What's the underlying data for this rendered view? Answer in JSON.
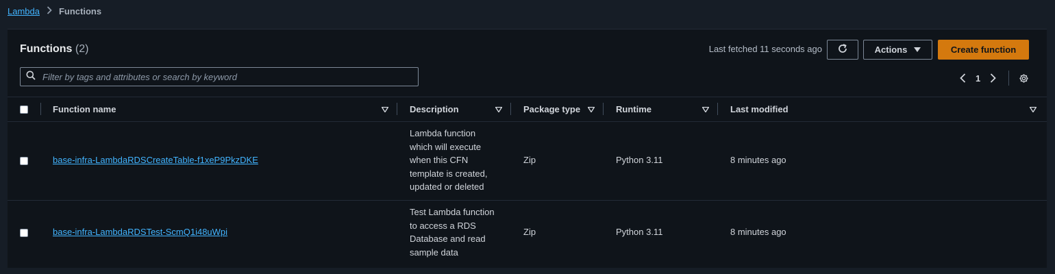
{
  "breadcrumb": {
    "root": "Lambda",
    "separator": "›",
    "current": "Functions"
  },
  "header": {
    "title": "Functions",
    "count": "(2)",
    "last_fetched": "Last fetched 11 seconds ago",
    "refresh_icon": "refresh-icon",
    "actions_label": "Actions",
    "create_label": "Create function"
  },
  "search": {
    "placeholder": "Filter by tags and attributes or search by keyword",
    "value": ""
  },
  "pagination": {
    "page": "1"
  },
  "table": {
    "columns": [
      "Function name",
      "Description",
      "Package type",
      "Runtime",
      "Last modified"
    ],
    "rows": [
      {
        "name": "base-infra-LambdaRDSCreateTable-f1xeP9PkzDKE",
        "description": [
          "Lambda function",
          "which will execute",
          "when this CFN",
          "template is created,",
          "updated or deleted"
        ],
        "package_type": "Zip",
        "runtime": "Python 3.11",
        "last_modified": "8 minutes ago"
      },
      {
        "name": "base-infra-LambdaRDSTest-ScmQ1i48uWpi",
        "description": [
          "Test Lambda function",
          "to access a RDS",
          "Database and read",
          "sample data"
        ],
        "package_type": "Zip",
        "runtime": "Python 3.11",
        "last_modified": "8 minutes ago"
      }
    ]
  },
  "colors": {
    "background": "#161d26",
    "panel": "#0f141a",
    "link": "#42b4ff",
    "primary_button": "#d4790e"
  }
}
